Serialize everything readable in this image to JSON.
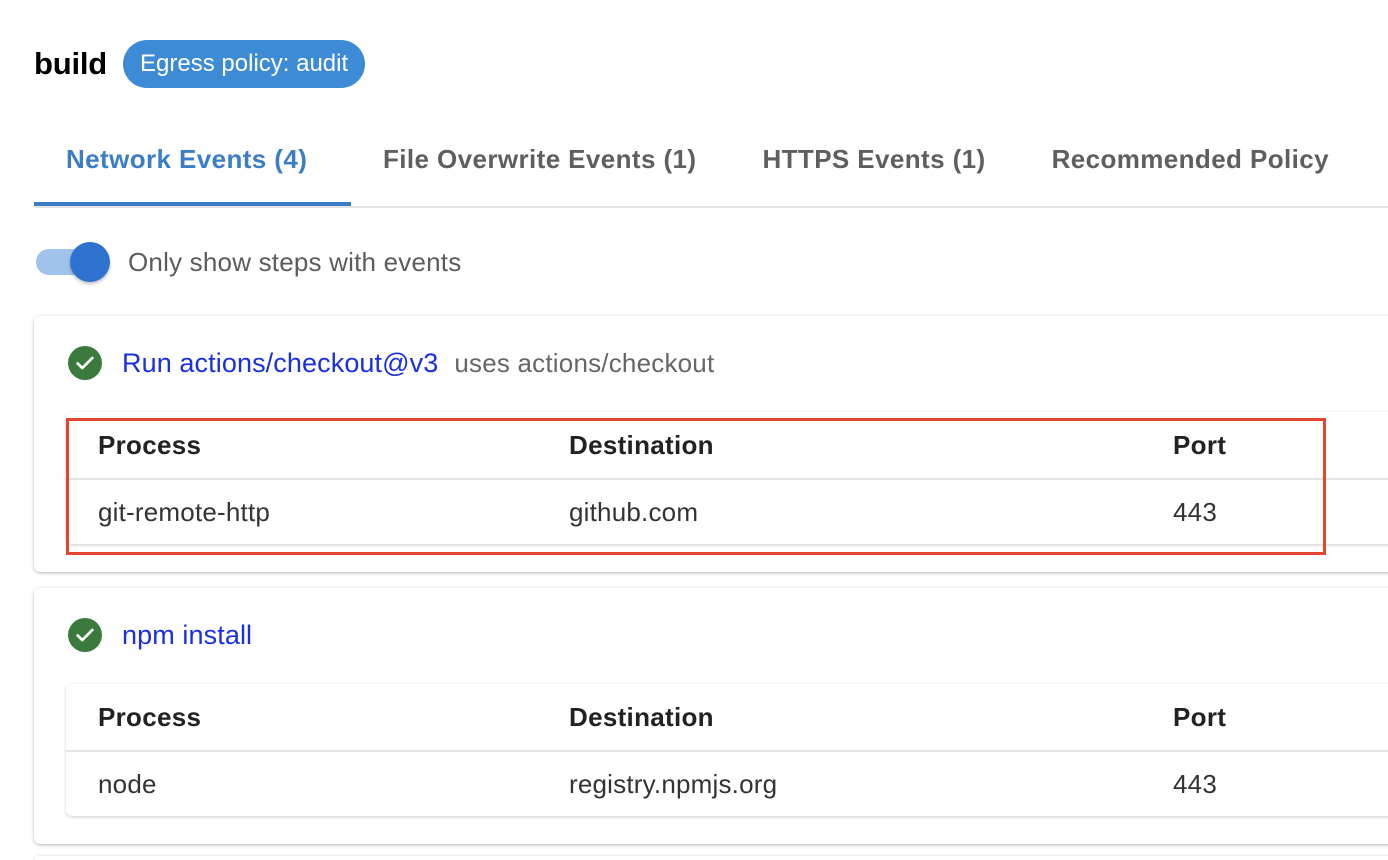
{
  "header": {
    "job_name": "build",
    "egress_policy": "Egress policy: audit"
  },
  "tabs": [
    {
      "label": "Network Events (4)",
      "active": true
    },
    {
      "label": "File Overwrite Events (1)",
      "active": false
    },
    {
      "label": "HTTPS Events (1)",
      "active": false
    },
    {
      "label": "Recommended Policy",
      "active": false
    }
  ],
  "toggle": {
    "label": "Only show steps with events",
    "on": true
  },
  "steps": [
    {
      "status": "success",
      "name": "Run actions/checkout@v3",
      "uses": "uses actions/checkout",
      "columns": [
        "Process",
        "Destination",
        "Port"
      ],
      "rows": [
        {
          "process": "git-remote-http",
          "destination": "github.com",
          "port": "443"
        }
      ],
      "highlighted": true
    },
    {
      "status": "success",
      "name": "npm install",
      "uses": "",
      "columns": [
        "Process",
        "Destination",
        "Port"
      ],
      "rows": [
        {
          "process": "node",
          "destination": "registry.npmjs.org",
          "port": "443"
        }
      ],
      "highlighted": false
    }
  ],
  "colors": {
    "accent": "#3c7ec5",
    "chip": "#3d8bd4",
    "link": "#1a2fe0",
    "success": "#3a7a3c",
    "highlight": "#e5442f"
  },
  "icons": {
    "step_status": "check-circle-icon"
  }
}
